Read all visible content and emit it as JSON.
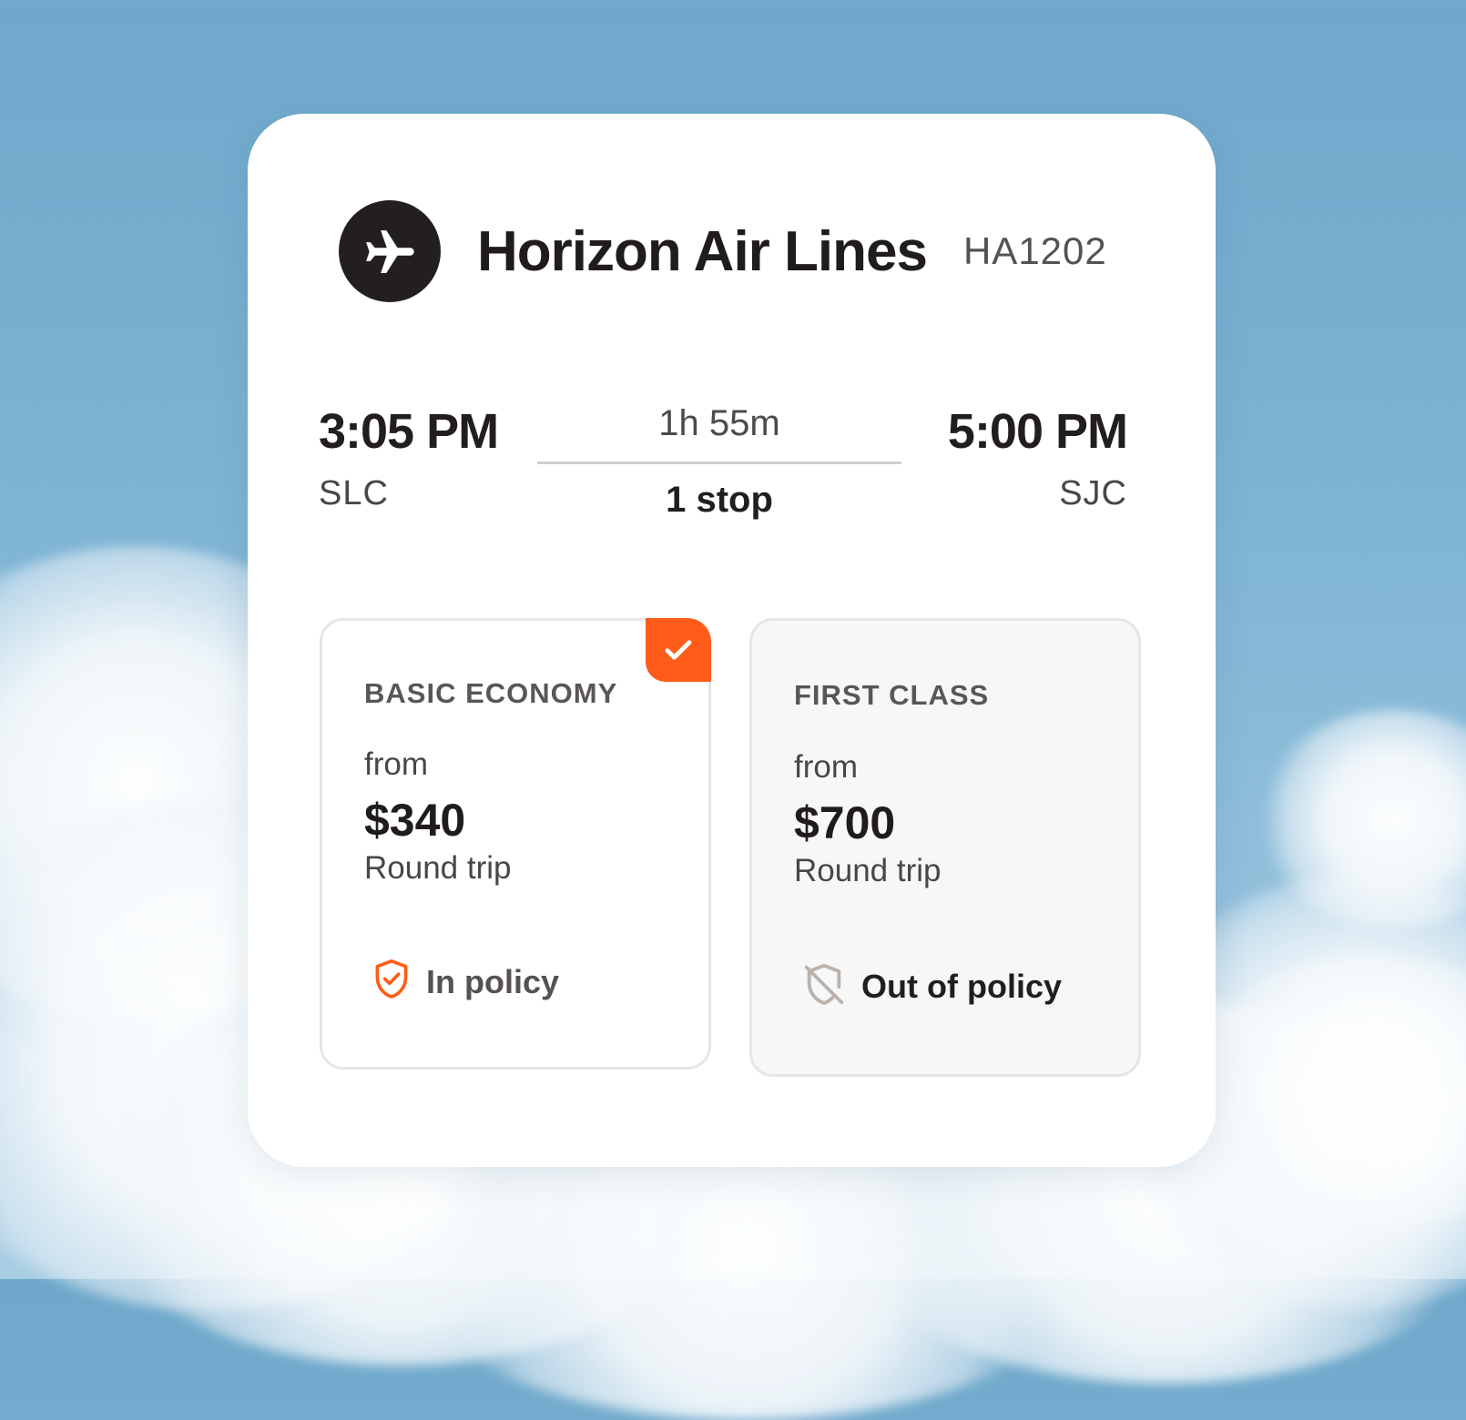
{
  "colors": {
    "accent": "#ff5c1a",
    "ink": "#221e1d",
    "sky": "#7cb2d3"
  },
  "flight": {
    "airline_name": "Horizon Air Lines",
    "flight_number": "HA1202",
    "logo_icon": "airplane-icon",
    "departure_time": "3:05 PM",
    "departure_code": "SLC",
    "arrival_time": "5:00 PM",
    "arrival_code": "SJC",
    "duration": "1h 55m",
    "stops": "1 stop"
  },
  "fares": [
    {
      "class_name": "BASIC ECONOMY",
      "from_label": "from",
      "price": "$340",
      "trip_type": "Round trip",
      "policy_label": "In policy",
      "policy_icon": "shield-check-icon",
      "selected": true,
      "selected_icon": "checkmark-icon"
    },
    {
      "class_name": "FIRST CLASS",
      "from_label": "from",
      "price": "$700",
      "trip_type": "Round trip",
      "policy_label": "Out of policy",
      "policy_icon": "shield-slash-icon",
      "selected": false
    }
  ]
}
